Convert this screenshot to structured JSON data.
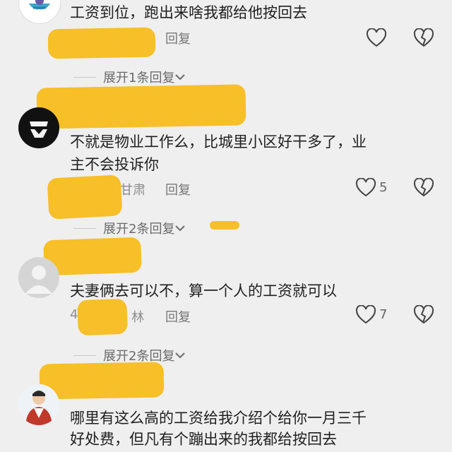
{
  "comments": [
    {
      "text": "工资到位，跑出来啥我都给他按回去",
      "meta": "",
      "reply": "回复",
      "likes": "",
      "expand": "展开1条回复"
    },
    {
      "text_line1": "不就是物业工作么，比城里小区好干多了，业",
      "text_line2": "主不会投诉你",
      "meta": "甘肃",
      "reply": "回复",
      "likes": "5",
      "expand": "展开2条回复"
    },
    {
      "text": "夫妻俩去可以不，算一个人的工资就可以",
      "meta_prefix": "4",
      "meta": "林",
      "reply": "回复",
      "likes": "7",
      "expand": "展开2条回复"
    },
    {
      "text_line1": "哪里有这么高的工资给我介绍个给你一月三千",
      "text_line2": "好处费，但凡有个蹦出来的我都给按回去"
    }
  ],
  "colors": {
    "highlight": "#f7bc1f",
    "background": "#efefef"
  }
}
